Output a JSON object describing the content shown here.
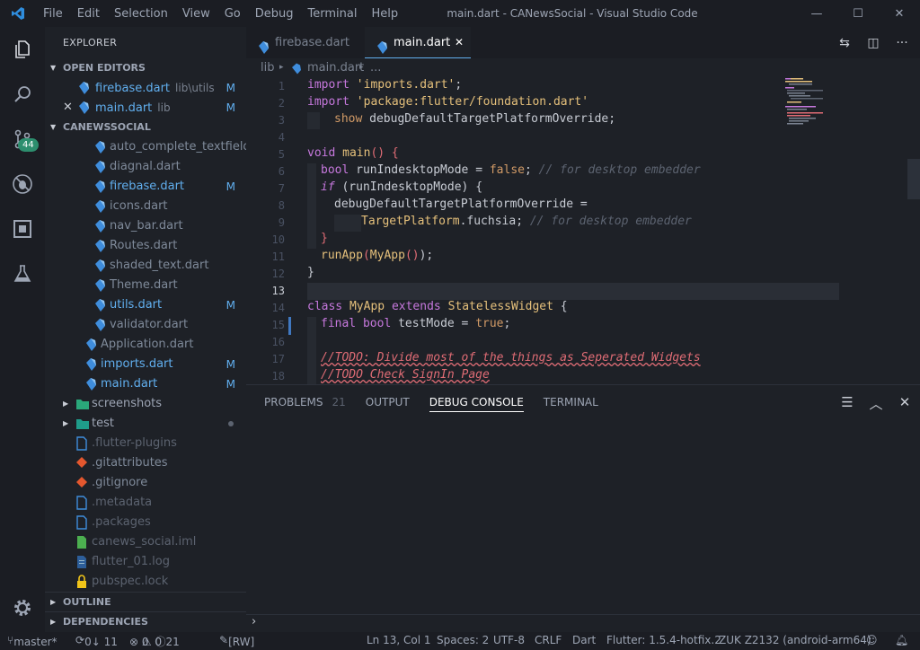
{
  "titlebar": {
    "menu": [
      "File",
      "Edit",
      "Selection",
      "View",
      "Go",
      "Debug",
      "Terminal",
      "Help"
    ],
    "title": "main.dart - CANewsSocial - Visual Studio Code"
  },
  "activity": {
    "scm_badge": "44"
  },
  "explorer": {
    "title": "EXPLORER",
    "open_editors_label": "OPEN EDITORS",
    "open_editors": [
      {
        "name": "firebase.dart",
        "desc": "lib\\utils",
        "status": "M"
      },
      {
        "name": "main.dart",
        "desc": "lib",
        "status": "M"
      }
    ],
    "project_label": "CANEWSSOCIAL",
    "files": [
      {
        "name": "auto_complete_textfield....",
        "status": ""
      },
      {
        "name": "diagnal.dart",
        "status": ""
      },
      {
        "name": "firebase.dart",
        "status": "M"
      },
      {
        "name": "icons.dart",
        "status": ""
      },
      {
        "name": "nav_bar.dart",
        "status": ""
      },
      {
        "name": "Routes.dart",
        "status": ""
      },
      {
        "name": "shaded_text.dart",
        "status": ""
      },
      {
        "name": "Theme.dart",
        "status": ""
      },
      {
        "name": "utils.dart",
        "status": "M"
      },
      {
        "name": "validator.dart",
        "status": ""
      },
      {
        "name": "Application.dart",
        "status": ""
      },
      {
        "name": "imports.dart",
        "status": "M"
      },
      {
        "name": "main.dart",
        "status": "M"
      },
      {
        "name": "screenshots",
        "status": ""
      },
      {
        "name": "test",
        "status": ""
      },
      {
        "name": ".flutter-plugins",
        "status": ""
      },
      {
        "name": ".gitattributes",
        "status": ""
      },
      {
        "name": ".gitignore",
        "status": ""
      },
      {
        "name": ".metadata",
        "status": ""
      },
      {
        "name": ".packages",
        "status": ""
      },
      {
        "name": "canews_social.iml",
        "status": ""
      },
      {
        "name": "flutter_01.log",
        "status": ""
      },
      {
        "name": "pubspec.lock",
        "status": ""
      }
    ],
    "outline_label": "OUTLINE",
    "dependencies_label": "DEPENDENCIES"
  },
  "tabs": [
    {
      "name": "firebase.dart"
    },
    {
      "name": "main.dart"
    }
  ],
  "breadcrumb": {
    "folder": "lib",
    "file": "main.dart",
    "more": "..."
  },
  "editor": {
    "line_numbers": [
      "1",
      "2",
      "3",
      "4",
      "5",
      "6",
      "7",
      "8",
      "9",
      "10",
      "11",
      "12",
      "13",
      "14",
      "15",
      "16",
      "17",
      "18"
    ],
    "code": {
      "l1_kw": "import",
      "l1_str": "'imports.dart'",
      "l1_end": ";",
      "l2_kw": "import",
      "l2_str": "'package:flutter/foundation.dart'",
      "l3_kw": "show",
      "l3_id": " debugDefaultTargetPlatformOverride;",
      "l5_kw": "void",
      "l5_fn": "main",
      "l5_rest": "() {",
      "l6_kw": "bool",
      "l6_id": " runIndesktopMode = ",
      "l6_val": "false",
      "l6_semi": "; ",
      "l6_cm": "// for desktop embedder",
      "l7_kw": "if",
      "l7_rest": " (runIndesktopMode) {",
      "l8_id": "debugDefaultTargetPlatformOverride =",
      "l9_cls": "TargetPlatform",
      "l9_id": ".fuchsia;",
      "l9_cm": " // for desktop embedder",
      "l10": "}",
      "l11_fn": "runApp",
      "l11_p1": "(",
      "l11_cls": "MyApp",
      "l11_p2": "()",
      "l11_end": ");",
      "l12": "}",
      "l14_kw": "class",
      "l14_cls": "MyApp",
      "l14_kw2": "extends",
      "l14_cls2": "StatelessWidget",
      "l14_end": " {",
      "l15_kw": "final",
      "l15_kw2": "bool",
      "l15_id": " testMode = ",
      "l15_val": "true",
      "l15_end": ";",
      "l17_todo": "//TODO: Divide most of the things as Seperated Widgets",
      "l18_todo": "//TODO Check SignIn Page"
    }
  },
  "panel": {
    "tabs": [
      {
        "label": "PROBLEMS",
        "count": "21"
      },
      {
        "label": "OUTPUT",
        "count": ""
      },
      {
        "label": "DEBUG CONSOLE",
        "count": ""
      },
      {
        "label": "TERMINAL",
        "count": ""
      }
    ],
    "prompt": "›"
  },
  "status": {
    "branch": "master*",
    "sync": "0↓ 11",
    "errors": "0",
    "warnings": "0",
    "infos": "21",
    "rw": "[RW]",
    "position": "Ln 13, Col 1",
    "spaces": "Spaces: 2",
    "encoding": "UTF-8",
    "eol": "CRLF",
    "language": "Dart",
    "flutter": "Flutter: 1.5.4-hotfix.2",
    "device": "ZUK Z2132 (android-arm64)"
  }
}
